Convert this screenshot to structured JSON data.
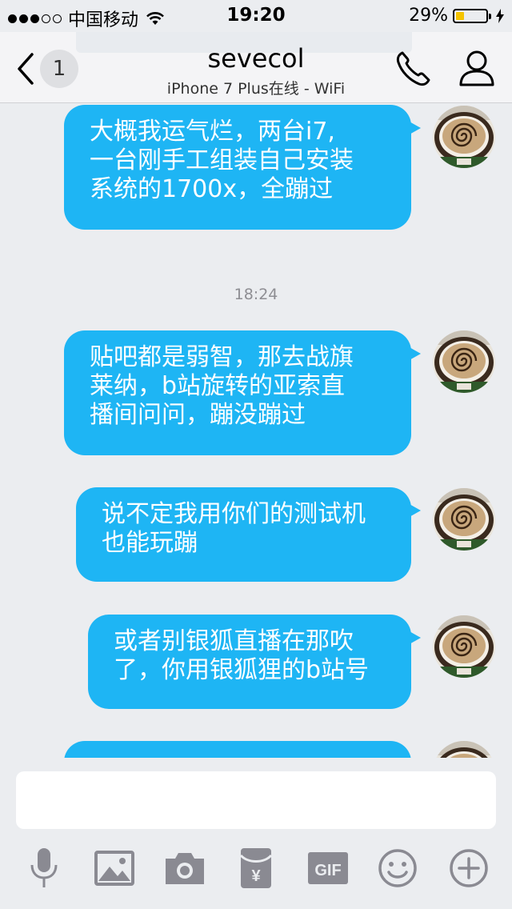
{
  "status_bar": {
    "carrier": "中国移动",
    "time": "19:20",
    "battery": "29%",
    "battery_level": 0.29,
    "signal_filled": 3,
    "signal_total": 5,
    "icons": [
      "wifi-icon",
      "battery-icon",
      "charging-icon"
    ]
  },
  "nav": {
    "back_count": "1",
    "title": "sevecol",
    "subtitle": "iPhone 7 Plus在线 - WiFi",
    "icons": [
      "back-chevron-icon",
      "phone-icon",
      "user-icon"
    ]
  },
  "chat": {
    "messages": [
      {
        "lines": [
          "大概我运气烂，两台i7,",
          "一台刚手工组装自己安装",
          "系统的1700x，全蹦过"
        ]
      },
      {
        "lines": [
          "贴吧都是弱智，那去战旗",
          "莱纳，b站旋转的亚索直",
          "播间问问，蹦没蹦过"
        ]
      },
      {
        "lines": [
          "说不定我用你们的测试机",
          "也能玩蹦"
        ]
      },
      {
        "lines": [
          "或者别银狐直播在那吹",
          "了，你用银狐狸的b站号"
        ]
      }
    ],
    "timestamp": "18:24",
    "avatar": "coffee-avatar"
  },
  "input": {
    "placeholder": "",
    "toolbar_icons": [
      "microphone-icon",
      "image-icon",
      "camera-icon",
      "red-packet-icon",
      "gif-icon",
      "emoji-icon",
      "plus-icon"
    ],
    "gif_label": "GIF",
    "yen_label": "¥"
  },
  "colors": {
    "bubble": "#1eb5f4",
    "background": "#ebedf0",
    "icon_gray": "#8a8a92",
    "battery_fill": "#f5c400"
  }
}
